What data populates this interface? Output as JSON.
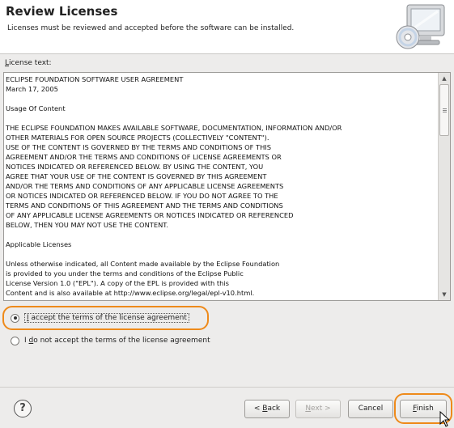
{
  "header": {
    "title": "Review Licenses",
    "subtitle": "Licenses must be reviewed and accepted before the software can be installed."
  },
  "license": {
    "label_mnemonic": "L",
    "label_rest": "icense text:",
    "text": "ECLIPSE FOUNDATION SOFTWARE USER AGREEMENT\nMarch 17, 2005\n\nUsage Of Content\n\nTHE ECLIPSE FOUNDATION MAKES AVAILABLE SOFTWARE, DOCUMENTATION, INFORMATION AND/OR\nOTHER MATERIALS FOR OPEN SOURCE PROJECTS (COLLECTIVELY \"CONTENT\").\nUSE OF THE CONTENT IS GOVERNED BY THE TERMS AND CONDITIONS OF THIS\nAGREEMENT AND/OR THE TERMS AND CONDITIONS OF LICENSE AGREEMENTS OR\nNOTICES INDICATED OR REFERENCED BELOW. BY USING THE CONTENT, YOU\nAGREE THAT YOUR USE OF THE CONTENT IS GOVERNED BY THIS AGREEMENT\nAND/OR THE TERMS AND CONDITIONS OF ANY APPLICABLE LICENSE AGREEMENTS\nOR NOTICES INDICATED OR REFERENCED BELOW. IF YOU DO NOT AGREE TO THE\nTERMS AND CONDITIONS OF THIS AGREEMENT AND THE TERMS AND CONDITIONS\nOF ANY APPLICABLE LICENSE AGREEMENTS OR NOTICES INDICATED OR REFERENCED\nBELOW, THEN YOU MAY NOT USE THE CONTENT.\n\nApplicable Licenses\n\nUnless otherwise indicated, all Content made available by the Eclipse Foundation\nis provided to you under the terms and conditions of the Eclipse Public\nLicense Version 1.0 (\"EPL\"). A copy of the EPL is provided with this\nContent and is also available at http://www.eclipse.org/legal/epl-v10.html.\nFor purposes of the EPL, \"Program\" will mean the Content."
  },
  "options": {
    "accept": {
      "mnemonic": "I",
      "rest": " accept the terms of the license agreement",
      "selected": true
    },
    "decline": {
      "pre": "I ",
      "mnemonic": "d",
      "rest": "o not accept the terms of the license agreement",
      "selected": false
    }
  },
  "buttons": {
    "help": "?",
    "back": {
      "pre": "< ",
      "mnemonic": "B",
      "rest": "ack"
    },
    "next": {
      "mnemonic": "N",
      "rest": "ext >"
    },
    "cancel": "Cancel",
    "finish": {
      "mnemonic": "F",
      "rest": "inish"
    }
  },
  "colors": {
    "highlight": "#ee8a1a"
  },
  "icons": {
    "banner": "computer-cd-icon",
    "help": "help-icon",
    "cursor": "mouse-pointer-icon"
  }
}
